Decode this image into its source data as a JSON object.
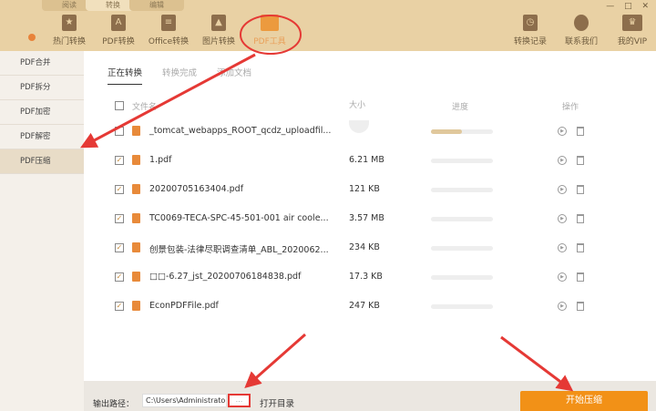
{
  "tabs": [
    "阅读",
    "转换",
    "编辑"
  ],
  "tools": [
    {
      "label": "热门转换",
      "icon": "star-icon"
    },
    {
      "label": "PDF转换",
      "icon": "pdf-icon"
    },
    {
      "label": "Office转换",
      "icon": "document-icon"
    },
    {
      "label": "图片转换",
      "icon": "image-icon"
    },
    {
      "label": "PDF工具",
      "icon": "toolbox-icon"
    }
  ],
  "right_tools": [
    {
      "label": "转换记录",
      "icon": "clock-icon"
    },
    {
      "label": "联系我们",
      "icon": "headset-icon"
    },
    {
      "label": "我的VIP",
      "icon": "crown-icon"
    }
  ],
  "window_controls": "— □ ✕",
  "sidebar": [
    "PDF合并",
    "PDF拆分",
    "PDF加密",
    "PDF解密",
    "PDF压缩"
  ],
  "main_tabs": [
    "正在转换",
    "转换完成",
    "添加文档"
  ],
  "columns": {
    "name": "文件名",
    "size": "大小",
    "progress": "进度",
    "actions": "操作"
  },
  "files": [
    {
      "name": "_tomcat_webapps_ROOT_qcdz_uploadfil...",
      "size": "",
      "checked": false,
      "progress": 0.5
    },
    {
      "name": "1.pdf",
      "size": "6.21 MB",
      "checked": true,
      "progress": 0
    },
    {
      "name": "20200705163404.pdf",
      "size": "121 KB",
      "checked": true,
      "progress": 0
    },
    {
      "name": "TC0069-TECA-SPC-45-501-001 air coole...",
      "size": "3.57 MB",
      "checked": true,
      "progress": 0
    },
    {
      "name": "创景包装-法律尽职调查清单_ABL_2020062...",
      "size": "234 KB",
      "checked": true,
      "progress": 0
    },
    {
      "name": "□□-6.27_jst_20200706184838.pdf",
      "size": "17.3 KB",
      "checked": true,
      "progress": 0
    },
    {
      "name": "EconPDFFile.pdf",
      "size": "247 KB",
      "checked": true,
      "progress": 0
    }
  ],
  "footer": {
    "label": "输出路径：",
    "path": "C:\\Users\\Administrator",
    "browse": "...",
    "open_dir": "打开目录",
    "start": "开始压缩"
  },
  "colors": {
    "accent": "#f29117",
    "annotation": "#e53935"
  }
}
